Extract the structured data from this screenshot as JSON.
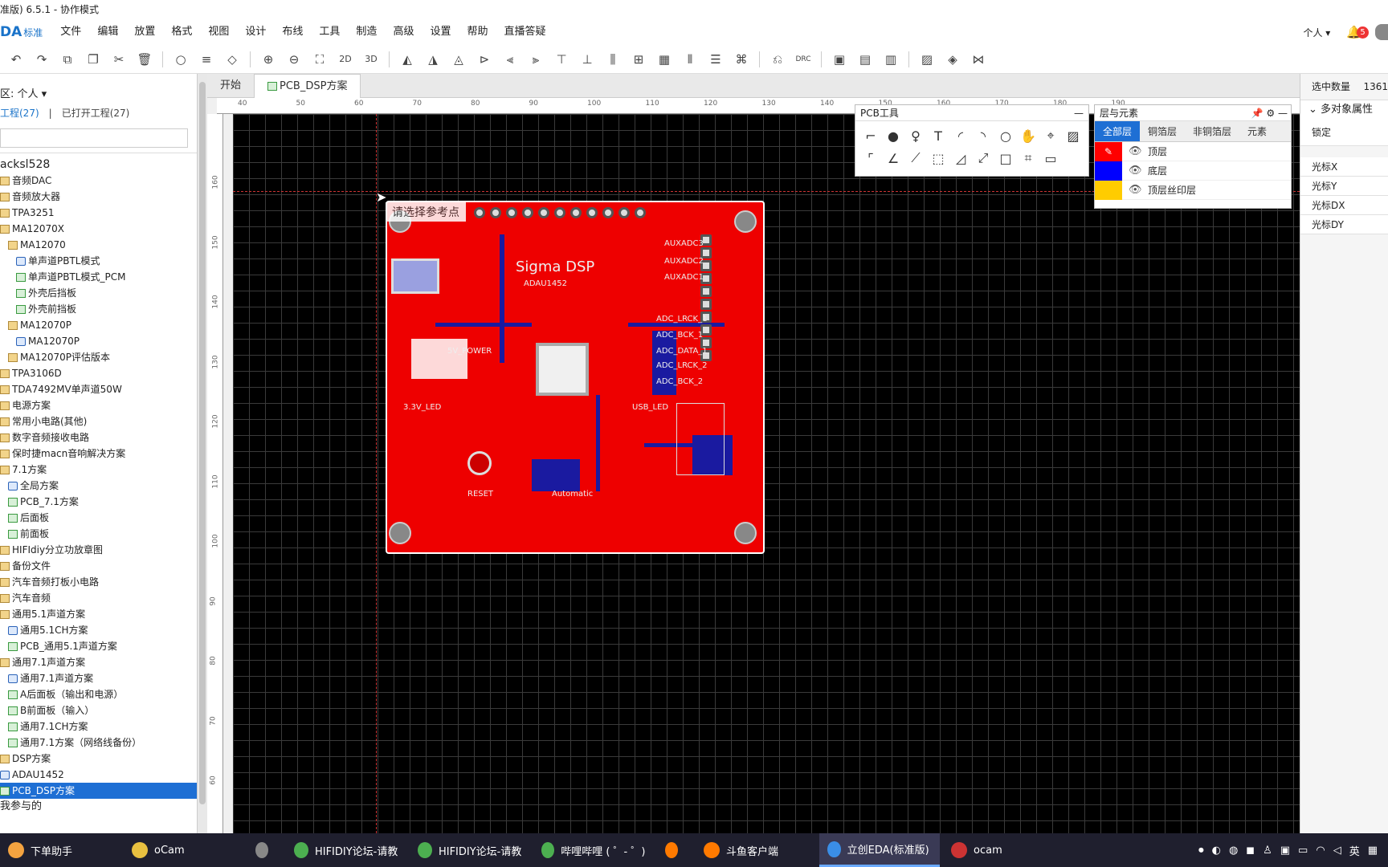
{
  "title": "准版) 6.5.1 - 协作模式",
  "menubar": {
    "logo": "DA",
    "logo_sub": "标准",
    "items": [
      "文件",
      "编辑",
      "放置",
      "格式",
      "视图",
      "设计",
      "布线",
      "工具",
      "制造",
      "高级",
      "设置",
      "帮助",
      "直播答疑"
    ],
    "user": "个人",
    "notification_count": "5"
  },
  "toolbar": {
    "label_2d": "2D",
    "label_3d": "3D",
    "label_drc": "DRC"
  },
  "left_panel": {
    "workspace": "区: 个人",
    "tab_projects": "工程(27)",
    "tab_opened": "已打开工程(27)",
    "tree": [
      {
        "label": "acksl528",
        "type": "none",
        "indent": 0,
        "size": 14
      },
      {
        "label": "音频DAC",
        "type": "folder",
        "indent": 0
      },
      {
        "label": "音频放大器",
        "type": "folder",
        "indent": 0
      },
      {
        "label": "TPA3251",
        "type": "folder",
        "indent": 0
      },
      {
        "label": "MA12070X",
        "type": "folder",
        "indent": 0
      },
      {
        "label": "MA12070",
        "type": "folder",
        "indent": 1
      },
      {
        "label": "单声道PBTL模式",
        "type": "sch",
        "indent": 2
      },
      {
        "label": "单声道PBTL模式_PCM",
        "type": "pcb",
        "indent": 2
      },
      {
        "label": "外壳后挡板",
        "type": "pcb",
        "indent": 2
      },
      {
        "label": "外壳前挡板",
        "type": "pcb",
        "indent": 2
      },
      {
        "label": "MA12070P",
        "type": "folder",
        "indent": 1
      },
      {
        "label": "MA12070P",
        "type": "sch",
        "indent": 2
      },
      {
        "label": "MA12070P评估版本",
        "type": "folder",
        "indent": 1
      },
      {
        "label": "TPA3106D",
        "type": "folder",
        "indent": 0
      },
      {
        "label": "TDA7492MV单声道50W",
        "type": "folder",
        "indent": 0
      },
      {
        "label": "电源方案",
        "type": "folder",
        "indent": 0
      },
      {
        "label": "常用小电路(其他)",
        "type": "folder",
        "indent": 0
      },
      {
        "label": "数字音频接收电路",
        "type": "folder",
        "indent": 0
      },
      {
        "label": "保时捷macn音响解决方案",
        "type": "folder",
        "indent": 0
      },
      {
        "label": "7.1方案",
        "type": "folder",
        "indent": 0
      },
      {
        "label": "全局方案",
        "type": "sch",
        "indent": 1
      },
      {
        "label": "PCB_7.1方案",
        "type": "pcb",
        "indent": 1
      },
      {
        "label": "后面板",
        "type": "pcb",
        "indent": 1
      },
      {
        "label": "前面板",
        "type": "pcb",
        "indent": 1
      },
      {
        "label": "HIFIdiy分立功放章图",
        "type": "folder",
        "indent": 0
      },
      {
        "label": "备份文件",
        "type": "folder",
        "indent": 0
      },
      {
        "label": "汽车音频打板小电路",
        "type": "folder",
        "indent": 0
      },
      {
        "label": "汽车音频",
        "type": "folder",
        "indent": 0
      },
      {
        "label": "通用5.1声道方案",
        "type": "folder",
        "indent": 0
      },
      {
        "label": "通用5.1CH方案",
        "type": "sch",
        "indent": 1
      },
      {
        "label": "PCB_通用5.1声道方案",
        "type": "pcb",
        "indent": 1
      },
      {
        "label": "通用7.1声道方案",
        "type": "folder",
        "indent": 0
      },
      {
        "label": "通用7.1声道方案",
        "type": "sch",
        "indent": 1
      },
      {
        "label": "A后面板（输出和电源）",
        "type": "pcb",
        "indent": 1
      },
      {
        "label": "B前面板（输入）",
        "type": "pcb",
        "indent": 1
      },
      {
        "label": "通用7.1CH方案",
        "type": "pcb",
        "indent": 1
      },
      {
        "label": "通用7.1方案（网络线备份）",
        "type": "pcb",
        "indent": 1
      },
      {
        "label": "DSP方案",
        "type": "folder",
        "indent": 0
      },
      {
        "label": "ADAU1452",
        "type": "sch",
        "indent": 0
      },
      {
        "label": "PCB_DSP方案",
        "type": "pcb",
        "indent": 0,
        "selected": true
      },
      {
        "label": "我参与的",
        "type": "none",
        "indent": 0,
        "size": 13
      }
    ]
  },
  "tabs": {
    "start": "开始",
    "active": "PCB_DSP方案"
  },
  "ruler": {
    "top": [
      "40",
      "50",
      "60",
      "70",
      "80",
      "90",
      "100",
      "110",
      "120",
      "130",
      "140",
      "150",
      "160",
      "170",
      "180",
      "190"
    ],
    "left": [
      "160",
      "150",
      "140",
      "130",
      "120",
      "110",
      "100",
      "90",
      "80",
      "70",
      "60"
    ]
  },
  "canvas": {
    "tooltip": "请选择参考点",
    "silk": [
      "Sigma DSP",
      "ADAU1452",
      "AUXADC3",
      "AUXADC2",
      "AUXADC1",
      "ADC_LRCK_1",
      "ADC_BCK_1",
      "ADC_DATA_1",
      "ADC_LRCK_2",
      "ADC_BCK_2",
      "3.3V_LED",
      "USB_LED",
      "RESET",
      "Automatic",
      "5V_POWER"
    ]
  },
  "pcb_tools": {
    "title": "PCB工具"
  },
  "layers": {
    "title": "层与元素",
    "tabs": [
      "全部层",
      "铜箔层",
      "非铜箔层",
      "元素"
    ],
    "rows": [
      {
        "name": "顶层",
        "color": "#ff0000"
      },
      {
        "name": "底层",
        "color": "#0000ff"
      },
      {
        "name": "顶层丝印层",
        "color": "#ffcc00"
      }
    ]
  },
  "right_panel": {
    "count_label": "选中数量",
    "count_value": "1361",
    "section": "多对象属性",
    "lock": "锁定",
    "fields": [
      "光标X",
      "光标Y",
      "光标DX",
      "光标DY"
    ]
  },
  "taskbar": {
    "items": [
      {
        "label": "下单助手",
        "color": "#f4a340"
      },
      {
        "label": "oCam",
        "color": "#e8c040"
      },
      {
        "label": "",
        "color": "#888"
      },
      {
        "label": "HIFIDIY论坛-请教...",
        "color": "#4caf50"
      },
      {
        "label": "HIFIDIY论坛-请教...",
        "color": "#4caf50"
      },
      {
        "label": "哔哩哔哩 ( ゜- ゜)つ...",
        "color": "#4caf50"
      },
      {
        "label": "",
        "color": "#ff7a00"
      },
      {
        "label": "斗鱼客户端",
        "color": "#ff7a00"
      },
      {
        "label": "立创EDA(标准版) 6...",
        "color": "#3a8ee6",
        "active": true
      },
      {
        "label": "ocam",
        "color": "#cc3333"
      }
    ],
    "lang": "英"
  }
}
